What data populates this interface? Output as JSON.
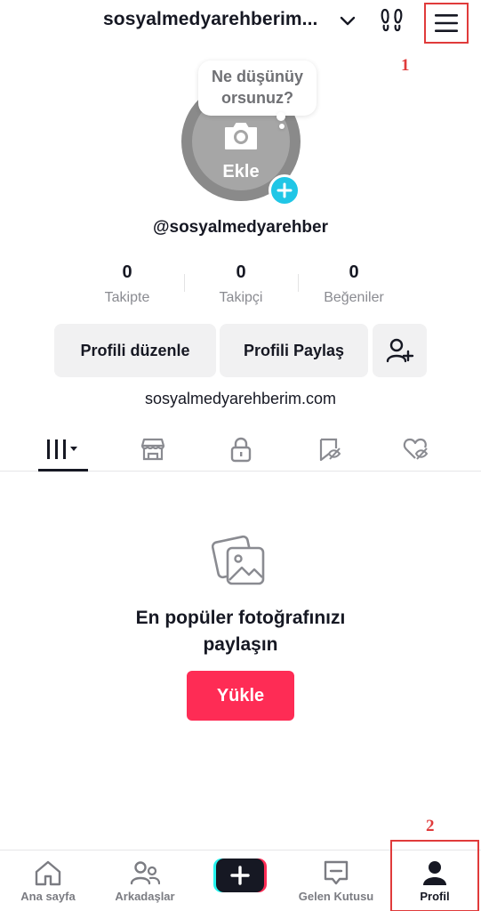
{
  "header": {
    "username": "sosyalmedyarehberim...",
    "icons": [
      "chevron-down-icon",
      "footprint-icon",
      "menu-icon"
    ]
  },
  "annotations": {
    "marker_1": "1",
    "marker_2": "2"
  },
  "avatar": {
    "bubble_text_line1": "Ne düşünüy",
    "bubble_text_line2": "orsunuz?",
    "add_label": "Ekle"
  },
  "profile": {
    "handle": "@sosyalmedyarehber",
    "website": "sosyalmedyarehberim.com"
  },
  "stats": [
    {
      "value": "0",
      "label": "Takipte"
    },
    {
      "value": "0",
      "label": "Takipçi"
    },
    {
      "value": "0",
      "label": "Beğeniler"
    }
  ],
  "buttons": {
    "edit": "Profili düzenle",
    "share": "Profili Paylaş"
  },
  "tabs": [
    "videos-grid-icon",
    "shop-icon",
    "lock-icon",
    "tagged-icon",
    "liked-icon"
  ],
  "empty_state": {
    "title_line1": "En popüler fotoğrafınızı",
    "title_line2": "paylaşın",
    "upload": "Yükle"
  },
  "bottom_nav": [
    {
      "label": "Ana sayfa"
    },
    {
      "label": "Arkadaşlar"
    },
    {
      "label": ""
    },
    {
      "label": "Gelen Kutusu"
    },
    {
      "label": "Profil"
    }
  ],
  "colors": {
    "accent": "#fe2c55",
    "badge": "#20c6e6",
    "annotation": "#e03b3b"
  }
}
